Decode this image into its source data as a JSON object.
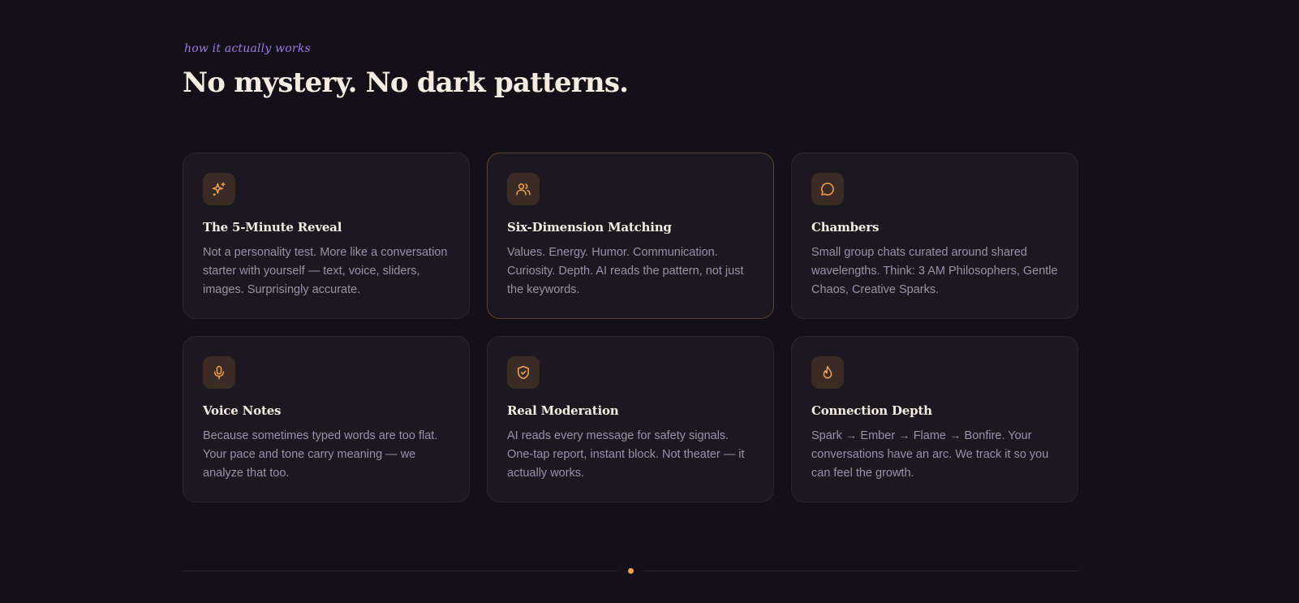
{
  "header": {
    "eyebrow": "how it actually works",
    "title": "No mystery. No dark patterns."
  },
  "accent_color": "#f0a256",
  "eyebrow_color": "#9d7ae8",
  "cards": [
    {
      "icon": "sparkles-icon",
      "title": "The 5-Minute Reveal",
      "description": "Not a personality test. More like a conversation starter with yourself — text, voice, sliders, images. Surprisingly accurate."
    },
    {
      "icon": "users-icon",
      "title": "Six-Dimension Matching",
      "description": "Values. Energy. Humor. Communication. Curiosity. Depth. AI reads the pattern, not just the keywords."
    },
    {
      "icon": "chat-bubble-icon",
      "title": "Chambers",
      "description": "Small group chats curated around shared wavelengths. Think: 3 AM Philosophers, Gentle Chaos, Creative Sparks."
    },
    {
      "icon": "microphone-icon",
      "title": "Voice Notes",
      "description": "Because sometimes typed words are too flat. Your pace and tone carry meaning — we analyze that too."
    },
    {
      "icon": "shield-check-icon",
      "title": "Real Moderation",
      "description": "AI reads every message for safety signals. One-tap report, instant block. Not theater — it actually works."
    },
    {
      "icon": "flame-icon",
      "title": "Connection Depth",
      "description": "Spark → Ember → Flame → Bonfire. Your conversations have an arc. We track it so you can feel the growth."
    }
  ]
}
